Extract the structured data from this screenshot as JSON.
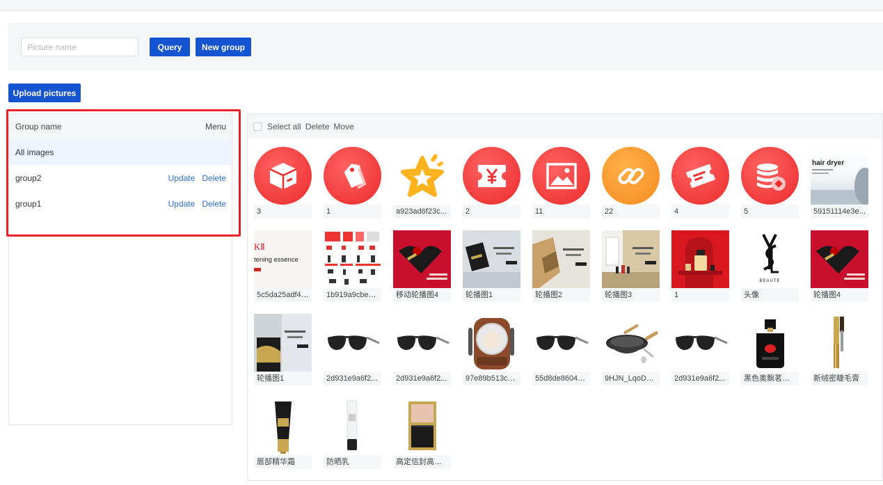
{
  "search": {
    "placeholder": "Picture name",
    "value": ""
  },
  "buttons": {
    "query": "Query",
    "new_group": "New group",
    "upload": "Upload pictures"
  },
  "groups": {
    "header_name": "Group name",
    "header_menu": "Menu",
    "rows": [
      {
        "name": "All images",
        "active": true
      },
      {
        "name": "group2",
        "update": "Update",
        "delete": "Delete"
      },
      {
        "name": "group1",
        "update": "Update",
        "delete": "Delete"
      }
    ]
  },
  "toolbar": {
    "select_all": "Select all",
    "delete": "Delete",
    "move": "Move"
  },
  "images": [
    {
      "caption": "3",
      "icon": "box-icon"
    },
    {
      "caption": "1",
      "icon": "tag-icon"
    },
    {
      "caption": "a923ad6f23c...",
      "icon": "star-icon"
    },
    {
      "caption": "2",
      "icon": "yen-ticket-icon"
    },
    {
      "caption": "11",
      "icon": "picture-icon"
    },
    {
      "caption": "22",
      "icon": "link-icon"
    },
    {
      "caption": "4",
      "icon": "coupon-icon"
    },
    {
      "caption": "5",
      "icon": "coins-icon"
    },
    {
      "caption": "59151114e3e...",
      "icon": "hair-dryer-banner",
      "banner_text": "hair dryer"
    },
    {
      "caption": "5c5da25adf4f...",
      "icon": "essence-banner",
      "banner_text": "tening essence"
    },
    {
      "caption": "1b919a9cbee...",
      "icon": "product-sheet-image"
    },
    {
      "caption": "移动轮播图4",
      "icon": "gift-box-image"
    },
    {
      "caption": "轮播图1",
      "icon": "carousel-gray-image"
    },
    {
      "caption": "轮播图2",
      "icon": "carousel-gold-image"
    },
    {
      "caption": "轮播图3",
      "icon": "carousel-store-image"
    },
    {
      "caption": "1",
      "icon": "perfume-red-image"
    },
    {
      "caption": "头像",
      "icon": "ysl-logo"
    },
    {
      "caption": "轮播图4",
      "icon": "gift-box-image"
    },
    {
      "caption": "轮播图1",
      "icon": "carousel-gold-box-image"
    },
    {
      "caption": "2d931e9a6f2...",
      "icon": "sunglasses-image"
    },
    {
      "caption": "2d931e9a6f2...",
      "icon": "sunglasses-image"
    },
    {
      "caption": "97e89b513cc...",
      "icon": "cat-backpack-image"
    },
    {
      "caption": "55d8de86047...",
      "icon": "sunglasses-image"
    },
    {
      "caption": "9HJN_LqoD_...",
      "icon": "wok-image"
    },
    {
      "caption": "2d931e9a6f2...",
      "icon": "sunglasses-image"
    },
    {
      "caption": "黑色奥飘茗女...",
      "icon": "perfume-black-image"
    },
    {
      "caption": "新绒密睫毛膏",
      "icon": "mascara-image"
    },
    {
      "caption": "唇部精华霜",
      "icon": "lip-tube-image"
    },
    {
      "caption": "防晒乳",
      "icon": "sunscreen-image"
    },
    {
      "caption": "高定信封高光...",
      "icon": "highlighter-image"
    }
  ],
  "colors": {
    "primary": "#1554d1",
    "link": "#2d6fd6",
    "highlight": "#e8212b",
    "icon_red": "#ec2b2b",
    "icon_orange": "#f68b1f"
  },
  "ysl_text": "BEAUTE"
}
